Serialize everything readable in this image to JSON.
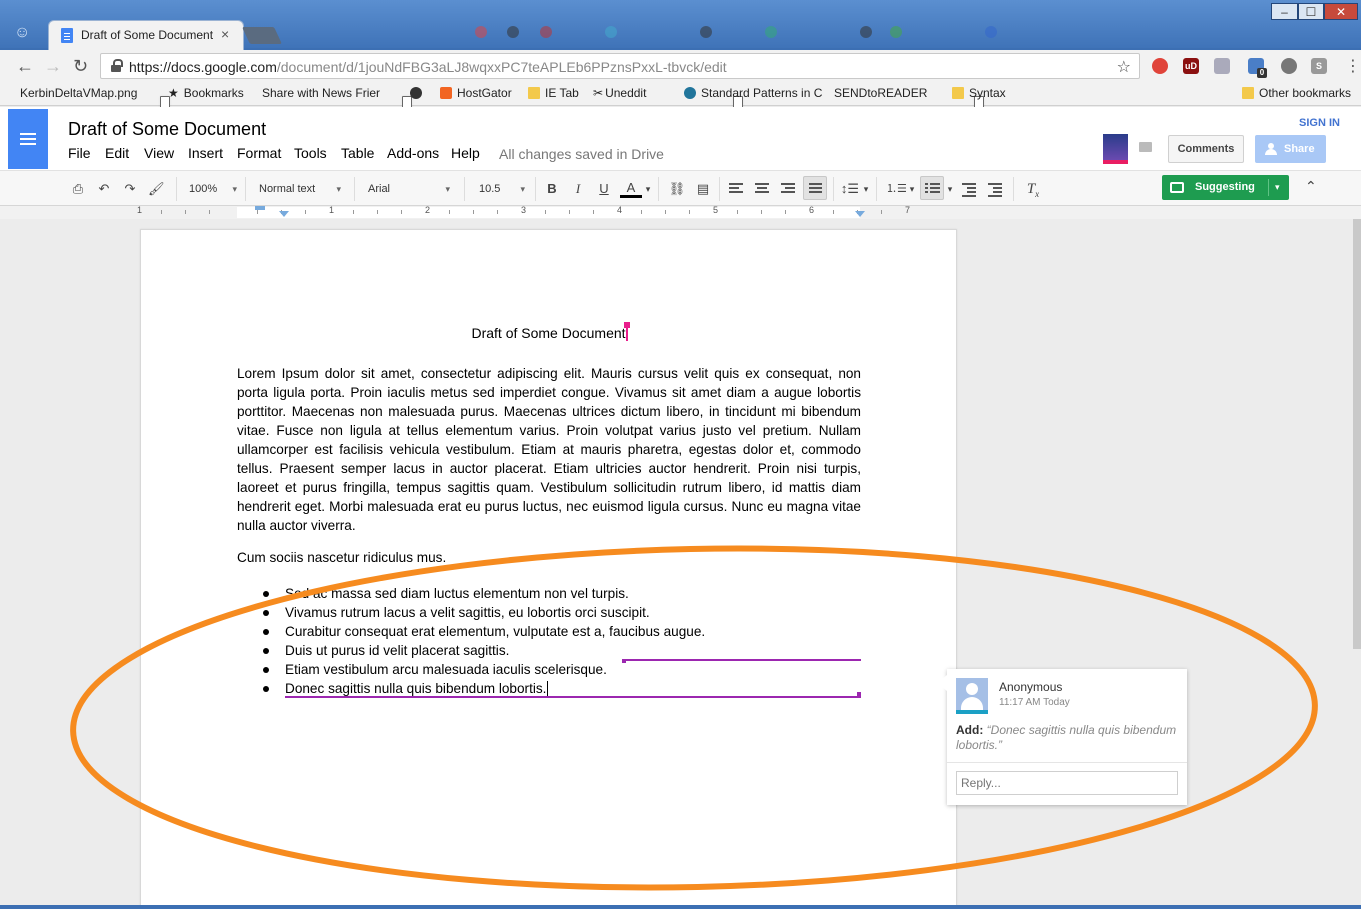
{
  "browser": {
    "tab_title": "Draft of Some Document",
    "tab_close": "×",
    "url_host": "https://docs.google.com",
    "url_path": "/document/d/1jouNdFBG3aLJ8wqxxPC7teAPLEb6PPznsPxxL-tbvck/edit",
    "window_controls": {
      "minimize": "–",
      "maximize": "☐",
      "close": "✕"
    },
    "extensions": [
      "shield-icon",
      "ublock-icon",
      "extension-icon",
      "ghostery-icon",
      "ball-icon",
      "s-icon"
    ],
    "extension_badge": "0",
    "ext_labels": [
      "",
      "uD",
      "",
      "",
      "",
      "S"
    ]
  },
  "bookmarks": [
    {
      "label": "KerbinDeltaVMap.png",
      "icon": "page"
    },
    {
      "label": "Bookmarks",
      "icon": "star"
    },
    {
      "label": "Share with News Frier",
      "icon": "page"
    },
    {
      "label": "",
      "icon": "skull"
    },
    {
      "label": "HostGator",
      "icon": "hostgator"
    },
    {
      "label": "IE Tab",
      "icon": "folder"
    },
    {
      "label": "Uneddit",
      "icon": "scissors"
    },
    {
      "label": "Standard Patterns in C",
      "icon": "wordpress"
    },
    {
      "label": "SENDtoREADER",
      "icon": "page"
    },
    {
      "label": "Syntax",
      "icon": "folder"
    },
    {
      "label": "Other bookmarks",
      "icon": "folder"
    }
  ],
  "docs": {
    "title": "Draft of Some Document",
    "menu": [
      "File",
      "Edit",
      "View",
      "Insert",
      "Format",
      "Tools",
      "Table",
      "Add-ons",
      "Help"
    ],
    "save_status": "All changes saved in Drive",
    "comments_label": "Comments",
    "share_label": "Share",
    "signin_label": "SIGN IN"
  },
  "toolbar": {
    "zoom": "100%",
    "style": "Normal text",
    "font": "Arial",
    "font_size": "10.5",
    "bold": "B",
    "italic": "I",
    "underline": "U",
    "text_color": "A",
    "mode": "Suggesting"
  },
  "ruler": {
    "numbers": [
      "1",
      "1",
      "2",
      "3",
      "4",
      "5",
      "6",
      "7"
    ]
  },
  "document": {
    "heading": "Draft of Some Document",
    "paragraph": "Lorem Ipsum dolor sit amet, consectetur adipiscing elit. Mauris cursus velit quis ex consequat, non porta ligula porta. Proin iaculis metus sed imperdiet congue. Vivamus sit amet diam a augue lobortis porttitor. Maecenas non malesuada purus. Maecenas ultrices dictum libero, in tincidunt mi bibendum vitae. Fusce non ligula at tellus elementum varius. Proin volutpat varius justo vel pretium. Nullam ullamcorper est facilisis vehicula vestibulum. Etiam at mauris pharetra, egestas dolor et, commodo tellus. Praesent semper lacus in auctor placerat. Etiam ultricies auctor hendrerit. Proin nisi turpis, laoreet et purus fringilla, tempus sagittis quam. Vestibulum sollicitudin rutrum libero, id mattis diam hendrerit eget. Morbi malesuada erat eu purus luctus, nec euismod ligula cursus. Nunc eu magna vitae nulla auctor viverra.",
    "paragraph2": "Cum sociis nascetur ridiculus mus.",
    "bullets": [
      "Sed ac massa sed diam luctus elementum non vel turpis.",
      "Vivamus rutrum lacus a velit sagittis, eu lobortis orci suscipit.",
      "Curabitur consequat erat elementum, vulputate est a, faucibus augue.",
      "Duis ut purus id velit placerat sagittis.",
      "Etiam vestibulum arcu malesuada iaculis scelerisque.",
      "Donec sagittis nulla quis bibendum lobortis."
    ]
  },
  "comment": {
    "author": "Anonymous",
    "time": "11:17 AM Today",
    "action": "Add:",
    "quote": "“Donec sagittis nulla quis bibendum lobortis.”",
    "reply_placeholder": "Reply..."
  },
  "colors": {
    "suggestion": "#9c27b0",
    "annotation": "#f68b1f",
    "suggesting_button": "#1e9c50",
    "docs_blue": "#4285f4"
  }
}
